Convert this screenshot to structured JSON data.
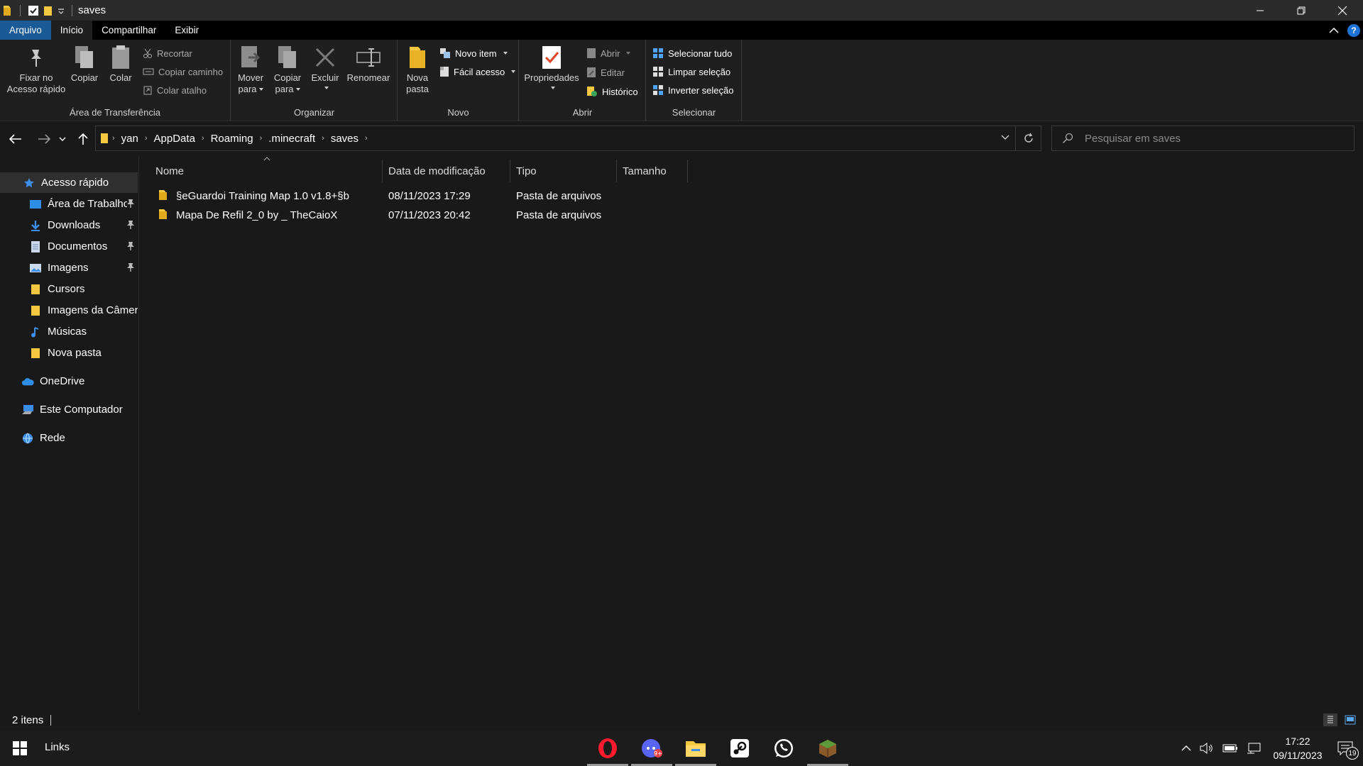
{
  "window": {
    "title": "saves"
  },
  "ribbon_tabs": [
    "Arquivo",
    "Início",
    "Compartilhar",
    "Exibir"
  ],
  "ribbon": {
    "clipboard": {
      "label": "Área de Transferência",
      "pin": "Fixar no Acesso rápido",
      "copy": "Copiar",
      "paste": "Colar",
      "cut": "Recortar",
      "copy_path": "Copiar caminho",
      "paste_shortcut": "Colar atalho"
    },
    "organize": {
      "label": "Organizar",
      "move_to_1": "Mover",
      "move_to_2": "para",
      "copy_to_1": "Copiar",
      "copy_to_2": "para",
      "delete": "Excluir",
      "rename": "Renomear"
    },
    "new": {
      "label": "Novo",
      "new_folder_1": "Nova",
      "new_folder_2": "pasta",
      "new_item": "Novo item",
      "easy_access": "Fácil acesso"
    },
    "open": {
      "label": "Abrir",
      "properties": "Propriedades",
      "open": "Abrir",
      "edit": "Editar",
      "history": "Histórico"
    },
    "select": {
      "label": "Selecionar",
      "select_all": "Selecionar tudo",
      "select_none": "Limpar seleção",
      "invert": "Inverter seleção"
    }
  },
  "address": {
    "crumbs": [
      "yan",
      "AppData",
      "Roaming",
      ".minecraft",
      "saves"
    ]
  },
  "search": {
    "placeholder": "Pesquisar em saves"
  },
  "nav": {
    "quick_access": "Acesso rápido",
    "items": [
      {
        "label": "Área de Trabalho",
        "pinned": true
      },
      {
        "label": "Downloads",
        "pinned": true
      },
      {
        "label": "Documentos",
        "pinned": true
      },
      {
        "label": "Imagens",
        "pinned": true
      },
      {
        "label": "Cursors",
        "pinned": false
      },
      {
        "label": "Imagens da Câmera",
        "pinned": false
      },
      {
        "label": "Músicas",
        "pinned": false
      },
      {
        "label": "Nova pasta",
        "pinned": false
      }
    ],
    "onedrive": "OneDrive",
    "this_pc": "Este Computador",
    "network": "Rede"
  },
  "columns": [
    "Nome",
    "Data de modificação",
    "Tipo",
    "Tamanho"
  ],
  "files": [
    {
      "name": "§eGuardoi Training Map 1.0 v1.8+§b",
      "modified": "08/11/2023 17:29",
      "type": "Pasta de arquivos",
      "size": ""
    },
    {
      "name": "Mapa De Refil 2_0 by _ TheCaioX",
      "modified": "07/11/2023 20:42",
      "type": "Pasta de arquivos",
      "size": ""
    }
  ],
  "status": {
    "count": "2 itens"
  },
  "taskbar": {
    "search_label": "Links",
    "clock_time": "17:22",
    "clock_date": "09/11/2023",
    "notifications": "19",
    "icons": [
      "opera-icon",
      "discord-icon",
      "file-explorer-icon",
      "steam-icon",
      "whatsapp-icon",
      "minecraft-icon"
    ]
  },
  "colors": {
    "accent": "#1a5a96",
    "folder": "#f5c842",
    "background": "#191919"
  }
}
